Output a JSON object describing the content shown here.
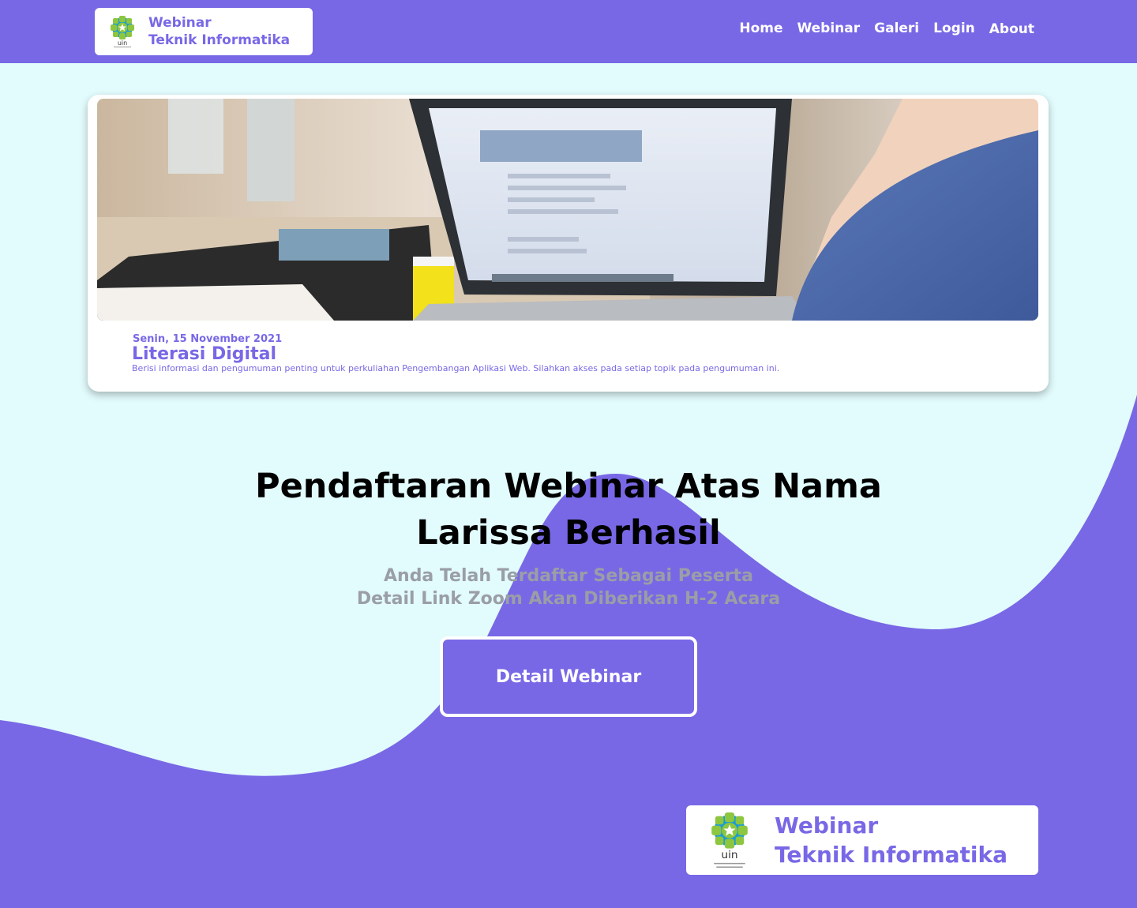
{
  "header": {
    "brand_line1": "Webinar",
    "brand_line2": "Teknik Informatika",
    "nav": [
      "Home",
      "Webinar",
      "Galeri",
      "Login",
      "About"
    ]
  },
  "card": {
    "date": "Senin, 15 November 2021",
    "title": "Literasi Digital",
    "description": "Berisi informasi dan pengumuman penting untuk perkuliahan Pengembangan Aplikasi Web. Silahkan akses pada setiap topik pada pengumuman ini.",
    "image_icon": "laptop-photo"
  },
  "main": {
    "headline_line1": "Pendaftaran Webinar Atas Nama",
    "headline_line2": "Larissa Berhasil",
    "sub_line1": "Anda Telah Terdaftar Sebagai Peserta",
    "sub_line2": "Detail Link Zoom Akan Diberikan H-2 Acara",
    "button_label": "Detail Webinar"
  },
  "footer": {
    "brand_line1": "Webinar",
    "brand_line2": "Teknik Informatika"
  },
  "logo_label": "uin",
  "colors": {
    "accent": "#7868e6",
    "background": "#e2fbfc",
    "subtext": "#9a9ea6",
    "logo_green": "#8dc63f",
    "logo_blue": "#1b9ad6"
  }
}
